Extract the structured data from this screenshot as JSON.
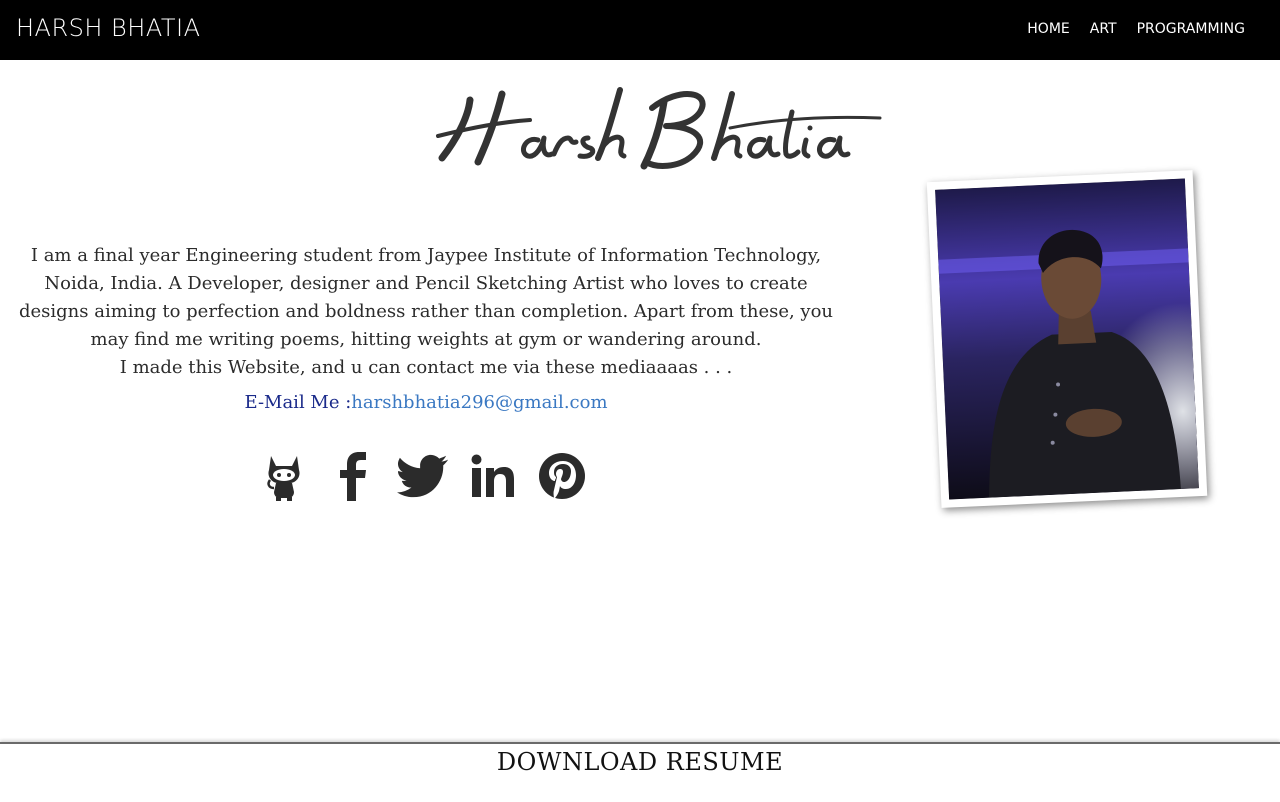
{
  "navbar": {
    "brand": "HARSH BHATIA",
    "links": [
      "HOME",
      "ART",
      "PROGRAMMING"
    ]
  },
  "header": {
    "signature": "Harsh Bhatia"
  },
  "bio": {
    "text": "I am a final year Engineering student from Jaypee Institute of Information Technology, Noida, India. A Developer, designer and Pencil Sketching Artist who loves to create designs aiming to perfection and boldness rather than completion. Apart from these, you may find me writing poems, hitting weights at gym or wandering around.",
    "contact_line": "I made this Website, and u can contact me via these mediaaaas . . ."
  },
  "contact": {
    "email_label": "E-Mail Me :",
    "email": "harshbhatia296@gmail.com"
  },
  "socials": [
    {
      "name": "github-icon"
    },
    {
      "name": "facebook-icon"
    },
    {
      "name": "twitter-icon"
    },
    {
      "name": "linkedin-icon"
    },
    {
      "name": "pinterest-icon"
    }
  ],
  "colors": {
    "navbar_bg": "#000000",
    "email_label": "#1a2a8a",
    "email_link": "#3a78c2",
    "icon": "#2b2b2b"
  },
  "footer": {
    "resume_label": "DOWNLOAD RESUME"
  }
}
